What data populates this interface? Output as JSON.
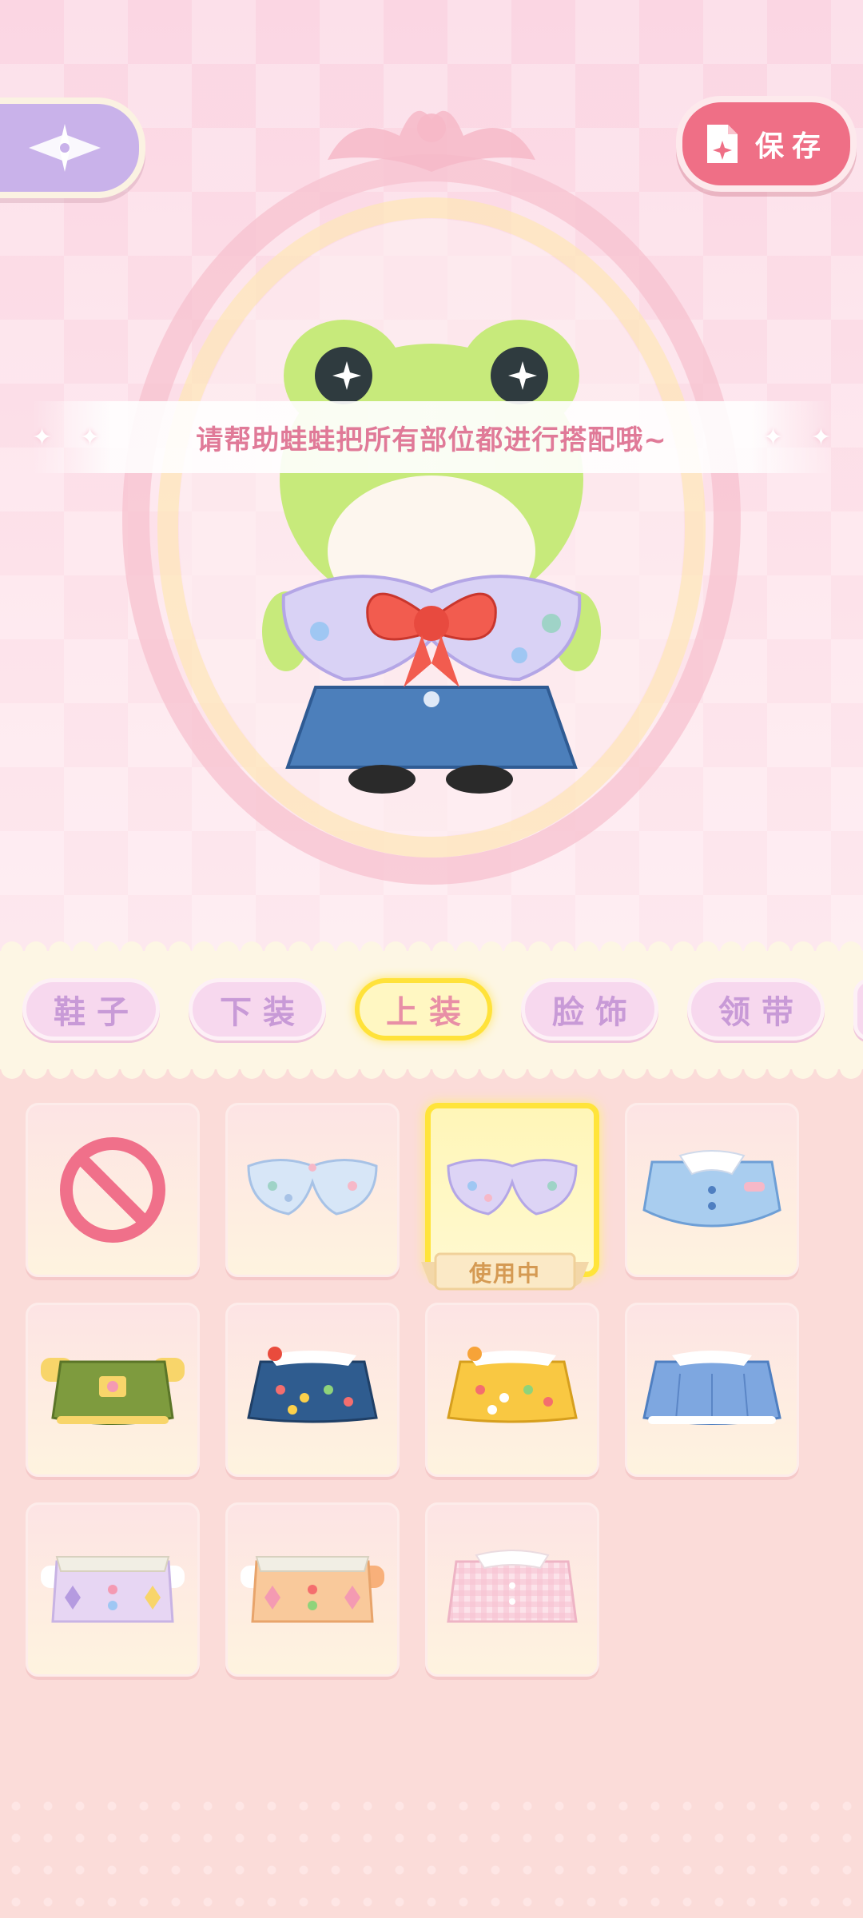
{
  "header": {
    "back_icon": "winged-star-back-icon",
    "save_label": "保存",
    "save_icon": "file-sparkle-icon"
  },
  "hint": "请帮助蛙蛙把所有部位都进行搭配哦~",
  "character": "frog-doll",
  "tabs": [
    {
      "label": "鞋子",
      "active": false
    },
    {
      "label": "下装",
      "active": false
    },
    {
      "label": "上装",
      "active": true
    },
    {
      "label": "脸饰",
      "active": false
    },
    {
      "label": "领带",
      "active": false
    }
  ],
  "items": [
    {
      "name": "none",
      "icon": "prohibited-icon",
      "selected": false
    },
    {
      "name": "blue-floral-collar",
      "selected": false
    },
    {
      "name": "lavender-floral-collar",
      "selected": true,
      "badge": "使用中"
    },
    {
      "name": "light-blue-jacket",
      "selected": false
    },
    {
      "name": "green-flower-overalls",
      "selected": false
    },
    {
      "name": "navy-polka-dot-dress-apple",
      "selected": false
    },
    {
      "name": "yellow-polka-dot-dress-orange",
      "selected": false
    },
    {
      "name": "blue-pleated-overalls",
      "selected": false
    },
    {
      "name": "lilac-argyle-top",
      "selected": false
    },
    {
      "name": "peach-argyle-top",
      "selected": false
    },
    {
      "name": "pink-gingham-top",
      "selected": false
    }
  ],
  "colors": {
    "accent_yellow": "#ffe23a",
    "save_pink": "#ef6f86",
    "back_purple": "#c9b2ea",
    "hint_pink": "#e07a98",
    "tab_text": "#c89ad7"
  }
}
